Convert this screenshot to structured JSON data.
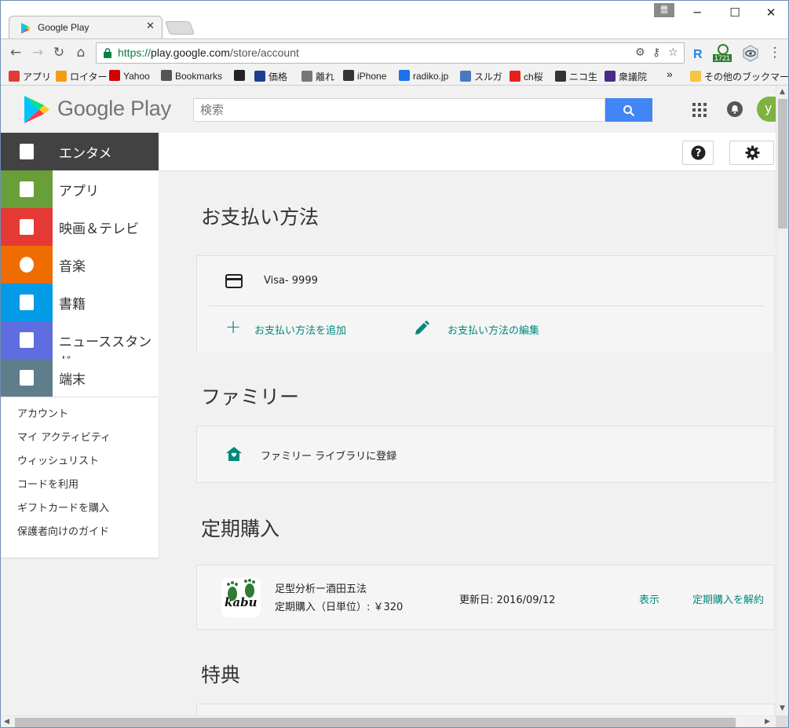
{
  "browser": {
    "tab_title": "Google Play",
    "profile_badge": "豊",
    "url_scheme": "https://",
    "url_host": "play.google.com",
    "url_path": "/store/account",
    "extension_badge": "1721"
  },
  "bookmarks": [
    {
      "label": "アプリ",
      "icon": "apps-grid-icon",
      "color": "#e53935"
    },
    {
      "label": "ロイター",
      "icon": "reuters-icon",
      "color": "#f39c12"
    },
    {
      "label": "Yahoo",
      "icon": "yahoo-icon",
      "color": "#d50000"
    },
    {
      "label": "Bookmarks",
      "icon": "star-icon",
      "color": "#555555"
    },
    {
      "label": "",
      "icon": "amazon-icon",
      "color": "#222222"
    },
    {
      "label": "価格",
      "icon": "kakaku-icon",
      "color": "#1e3f91"
    },
    {
      "label": "離れ",
      "icon": "page-icon",
      "color": "#777777"
    },
    {
      "label": "iPhone",
      "icon": "apple-icon",
      "color": "#333333"
    },
    {
      "label": "radiko.jp",
      "icon": "radiko-icon",
      "color": "#1a73e8"
    },
    {
      "label": "スルガ",
      "icon": "surugaya-icon",
      "color": "#4a79c1"
    },
    {
      "label": "ch桜",
      "icon": "youtube-icon",
      "color": "#e62117"
    },
    {
      "label": "ニコ生",
      "icon": "niconico-icon",
      "color": "#333333"
    },
    {
      "label": "衆議院",
      "icon": "shugiin-icon",
      "color": "#4b2a8a"
    }
  ],
  "bookmarks_overflow": "»",
  "bookmarks_other": "その他のブックマーク",
  "play": {
    "logo_text": "Google Play",
    "search_placeholder": "検索",
    "avatar_letter": "y"
  },
  "sidebar": {
    "categories": [
      {
        "label": "エンタメ",
        "color": "#424242",
        "icon": "entertainment-icon"
      },
      {
        "label": "アプリ",
        "color": "#689f38",
        "icon": "android-icon"
      },
      {
        "label": "映画＆テレビ",
        "color": "#e53935",
        "icon": "film-icon"
      },
      {
        "label": "音楽",
        "color": "#ef6c00",
        "icon": "music-icon"
      },
      {
        "label": "書籍",
        "color": "#039be5",
        "icon": "book-icon"
      },
      {
        "label": "ニューススタンド",
        "color": "#5e6ee0",
        "icon": "newsstand-icon"
      },
      {
        "label": "端末",
        "color": "#607d8b",
        "icon": "devices-icon"
      }
    ],
    "links": [
      "アカウント",
      "マイ アクティビティ",
      "ウィッシュリスト",
      "コードを利用",
      "ギフトカードを購入",
      "保護者向けのガイド"
    ]
  },
  "payment": {
    "title": "お支払い方法",
    "card_label": "Visa- 9999",
    "add_label": "お支払い方法を追加",
    "edit_label": "お支払い方法の編集"
  },
  "family": {
    "title": "ファミリー",
    "join_label": "ファミリー ライブラリに登録"
  },
  "subscriptions": {
    "title": "定期購入",
    "app_icon_text": "kabu",
    "app_name": "足型分析ー酒田五法",
    "plan": "定期購入（日単位）: ￥320",
    "renewal": "更新日: 2016/09/12",
    "view_label": "表示",
    "cancel_label": "定期購入を解約"
  },
  "perks": {
    "title": "特典"
  },
  "colors": {
    "accent_teal": "#00897b",
    "search_blue": "#4285f4",
    "avatar_green": "#7cb342"
  }
}
